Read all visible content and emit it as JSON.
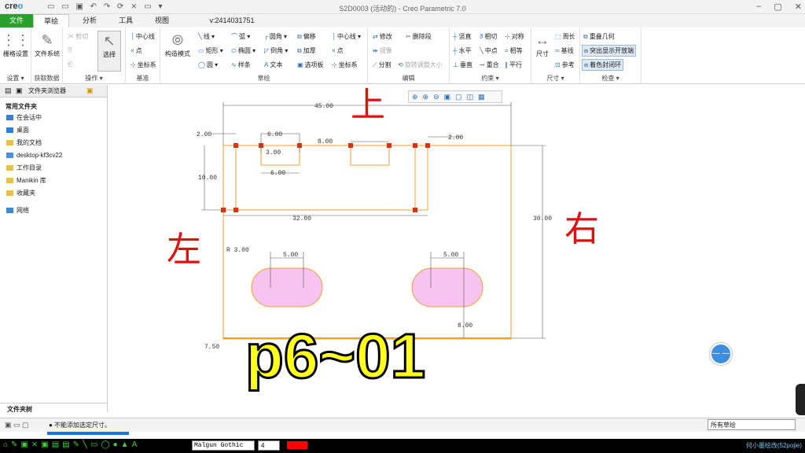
{
  "window": {
    "logo_prefix": "cre",
    "logo_suffix": "o",
    "title": "S2D0003 (活动的) - Creo Parametric 7.0",
    "quick_access": "▭ ▭ ▣ ↶ ↷ ⟳ ⨯ ▭ ▾"
  },
  "tabs": [
    "文件",
    "草绘",
    "分析",
    "工具",
    "视图",
    "v:2414031751"
  ],
  "ribbon": {
    "groups": [
      {
        "label": "设置 ▾",
        "items": [
          "栅格设置"
        ]
      },
      {
        "label": "获取数据",
        "items": [
          "文件系统"
        ]
      },
      {
        "label": "操作 ▾",
        "items": [
          "选择"
        ]
      },
      {
        "label": "基准",
        "items": [
          "中心线",
          "点",
          "坐标系"
        ]
      },
      {
        "label": "草绘",
        "items": [
          "构造模式",
          "线 ▾",
          "矩形 ▾",
          "圆 ▾",
          "弧 ▾",
          "椭圆 ▾",
          "样条",
          "圆角 ▾",
          "倒角 ▾",
          "文本",
          "偏移",
          "加厚",
          "选项板",
          "中心线 ▾",
          "点",
          "坐标系"
        ]
      },
      {
        "label": "编辑",
        "items": [
          "修改",
          "删除段",
          "镜像",
          "分割",
          "旋转调整大小"
        ]
      },
      {
        "label": "约束 ▾",
        "items": [
          "竖直",
          "相切",
          "对称",
          "水平",
          "中点",
          "相等",
          "垂直",
          "重合",
          "平行"
        ]
      },
      {
        "label": "尺寸 ▾",
        "items": [
          "尺寸",
          "周长",
          "基线",
          "参考"
        ]
      },
      {
        "label": "检查 ▾",
        "items": [
          "重叠几何",
          "突出显示开放端",
          "着色封闭环"
        ]
      }
    ]
  },
  "sidebar": {
    "tab": "文件夹浏览器",
    "heading": "常用文件夹",
    "items": [
      "在会话中",
      "桌面",
      "我的文档",
      "desktop-kf3cv22",
      "工作目录",
      "Manikin 库",
      "收藏夹",
      "网络"
    ],
    "footer": "文件夹树"
  },
  "sketch": {
    "dims": [
      "45.00",
      "2.00",
      "6.00",
      "3.00",
      "8.00",
      "2.00",
      "6.00",
      "10.00",
      "32.00",
      "30.00",
      "R 3.00",
      "5.00",
      "5.00",
      "8.00",
      "7.50"
    ],
    "annotations": [
      "上",
      "左",
      "右"
    ]
  },
  "overlay_text": "p6~01",
  "status": {
    "message": "● 不能添加选定尺寸。",
    "filter": "所有草绘"
  },
  "taskbar": {
    "font": "Malgun Gothic",
    "size": "4",
    "right": "何小墨绘改(52pojie)",
    "pen_color": "#ff0000"
  },
  "colors": {
    "accent": "#2aa12d",
    "sketch": "#f0a030",
    "slot_fill": "#f6c4ee"
  }
}
